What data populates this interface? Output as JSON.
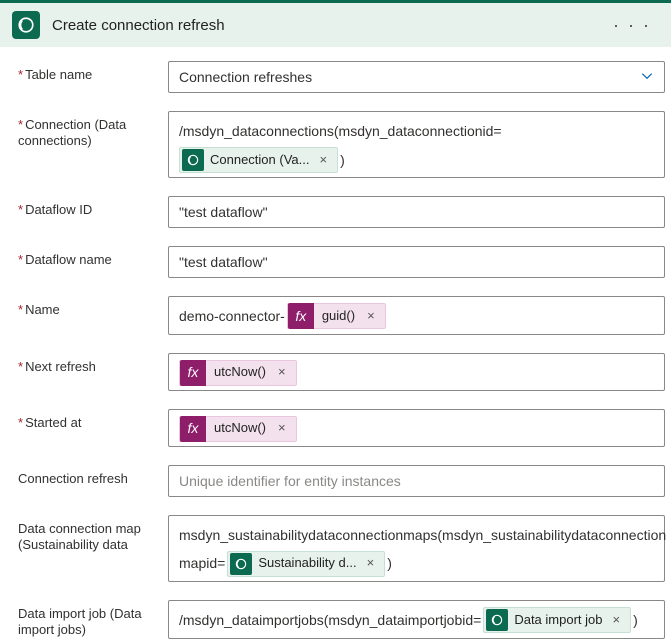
{
  "header": {
    "title": "Create connection refresh",
    "more": "· · ·"
  },
  "fields": {
    "tableName": {
      "label": "Table name",
      "value": "Connection refreshes"
    },
    "connection": {
      "label": "Connection (Data connections)",
      "prefix": "/msdyn_dataconnections(msdyn_dataconnectionid=",
      "token": "Connection (Va...",
      "suffix": ")"
    },
    "dataflowId": {
      "label": "Dataflow ID",
      "value": "\"test dataflow\""
    },
    "dataflowName": {
      "label": "Dataflow name",
      "value": "\"test dataflow\""
    },
    "name": {
      "label": "Name",
      "prefix": "demo-connector-",
      "fx": "guid()"
    },
    "nextRefresh": {
      "label": "Next refresh",
      "fx": "utcNow()"
    },
    "startedAt": {
      "label": "Started at",
      "fx": "utcNow()"
    },
    "connectionRefresh": {
      "label": "Connection refresh",
      "placeholder": "Unique identifier for entity instances"
    },
    "dataConnectionMap": {
      "label": "Data connection map (Sustainability data",
      "line1": "msdyn_sustainabilitydataconnectionmaps(msdyn_sustainabilitydataconnection",
      "line2pre": "mapid=",
      "token": "Sustainability d...",
      "suffix": ")"
    },
    "dataImportJob": {
      "label": "Data import job (Data import jobs)",
      "prefix": "/msdyn_dataimportjobs(msdyn_dataimportjobid=",
      "token": "Data import job",
      "suffix": ")"
    }
  }
}
